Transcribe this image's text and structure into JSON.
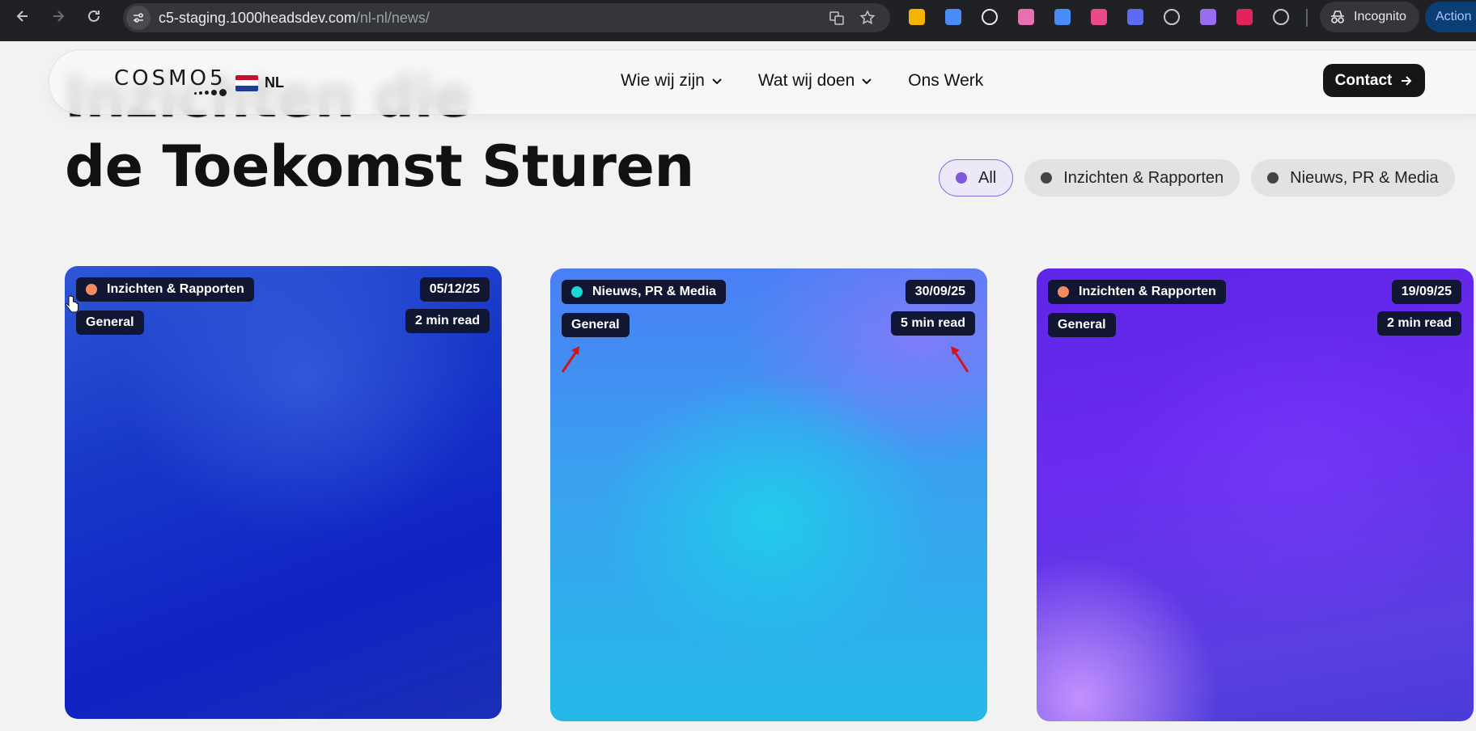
{
  "browser": {
    "url_host": "c5-staging.1000headsdev.com",
    "url_path": "/nl-nl/news/",
    "incognito_label": "Incognito",
    "action_label": "Action n",
    "extension_colors": [
      "#f4b400",
      "#4a8cf7",
      "#e8eaed",
      "#e86fb0",
      "#4a8cf7",
      "#e94a8a",
      "#5b6cf0",
      "#c4c7c5",
      "#9a6cf0",
      "#e0245e",
      "#c4c7c5"
    ]
  },
  "header": {
    "logo_text": "COSMO5",
    "language": "NL",
    "nav": [
      {
        "label": "Wie wij zijn",
        "has_dropdown": true
      },
      {
        "label": "Wat wij doen",
        "has_dropdown": true
      },
      {
        "label": "Ons Werk",
        "has_dropdown": false
      }
    ],
    "contact_label": "Contact"
  },
  "hero": {
    "title_line1": "Inzichten die",
    "title_line2": "de Toekomst Sturen"
  },
  "filters": [
    {
      "label": "All",
      "active": true
    },
    {
      "label": "Inzichten & Rapporten",
      "active": false
    },
    {
      "label": "Nieuws, PR & Media",
      "active": false
    }
  ],
  "cards": [
    {
      "category": "Inzichten & Rapporten",
      "category_color": "#f28a62",
      "subcategory": "General",
      "date": "05/12/25",
      "read_time": "2 min read"
    },
    {
      "category": "Nieuws, PR & Media",
      "category_color": "#1ed6d6",
      "subcategory": "General",
      "date": "30/09/25",
      "read_time": "5 min read"
    },
    {
      "category": "Inzichten & Rapporten",
      "category_color": "#f28a62",
      "subcategory": "General",
      "date": "19/09/25",
      "read_time": "2 min read"
    }
  ],
  "colors": {
    "annotation_arrow": "#d0161d",
    "active_chip_accent": "#7c5ad9",
    "contact_bg": "#161616"
  }
}
